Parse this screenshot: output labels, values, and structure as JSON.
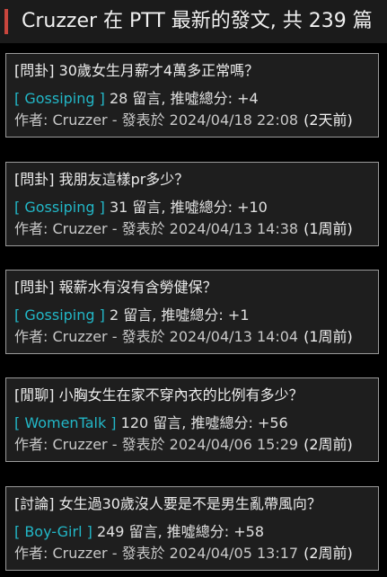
{
  "header": {
    "title": "Cruzzer 在 PTT 最新的發文, 共 239 篇",
    "accent_color": "#c9463d"
  },
  "labels": {
    "comments_suffix": "留言, 推噓總分:",
    "author_prefix": "作者:",
    "posted_at": "- 發表於"
  },
  "board_color": "#22b7c7",
  "posts": [
    {
      "title": "[問卦] 30歲女生月薪才4萬多正常嗎？",
      "board": "[ Gossiping ]",
      "comments": "28",
      "score": "+4",
      "author": "Cruzzer",
      "datetime": "2024/04/18 22:08",
      "ago": "(2天前)"
    },
    {
      "title": "[問卦] 我朋友這樣pr多少？",
      "board": "[ Gossiping ]",
      "comments": "31",
      "score": "+10",
      "author": "Cruzzer",
      "datetime": "2024/04/13 14:38",
      "ago": "(1周前)"
    },
    {
      "title": "[問卦] 報薪水有沒有含勞健保？",
      "board": "[ Gossiping ]",
      "comments": "2",
      "score": "+1",
      "author": "Cruzzer",
      "datetime": "2024/04/13 14:04",
      "ago": "(1周前)"
    },
    {
      "title": "[閒聊] 小胸女生在家不穿內衣的比例有多少？",
      "board": "[ WomenTalk ]",
      "comments": "120",
      "score": "+56",
      "author": "Cruzzer",
      "datetime": "2024/04/06 15:29",
      "ago": "(2周前)"
    },
    {
      "title": "[討論] 女生過30歲沒人要是不是男生亂帶風向？",
      "board": "[ Boy-Girl ]",
      "comments": "249",
      "score": "+58",
      "author": "Cruzzer",
      "datetime": "2024/04/05 13:17",
      "ago": "(2周前)"
    }
  ]
}
